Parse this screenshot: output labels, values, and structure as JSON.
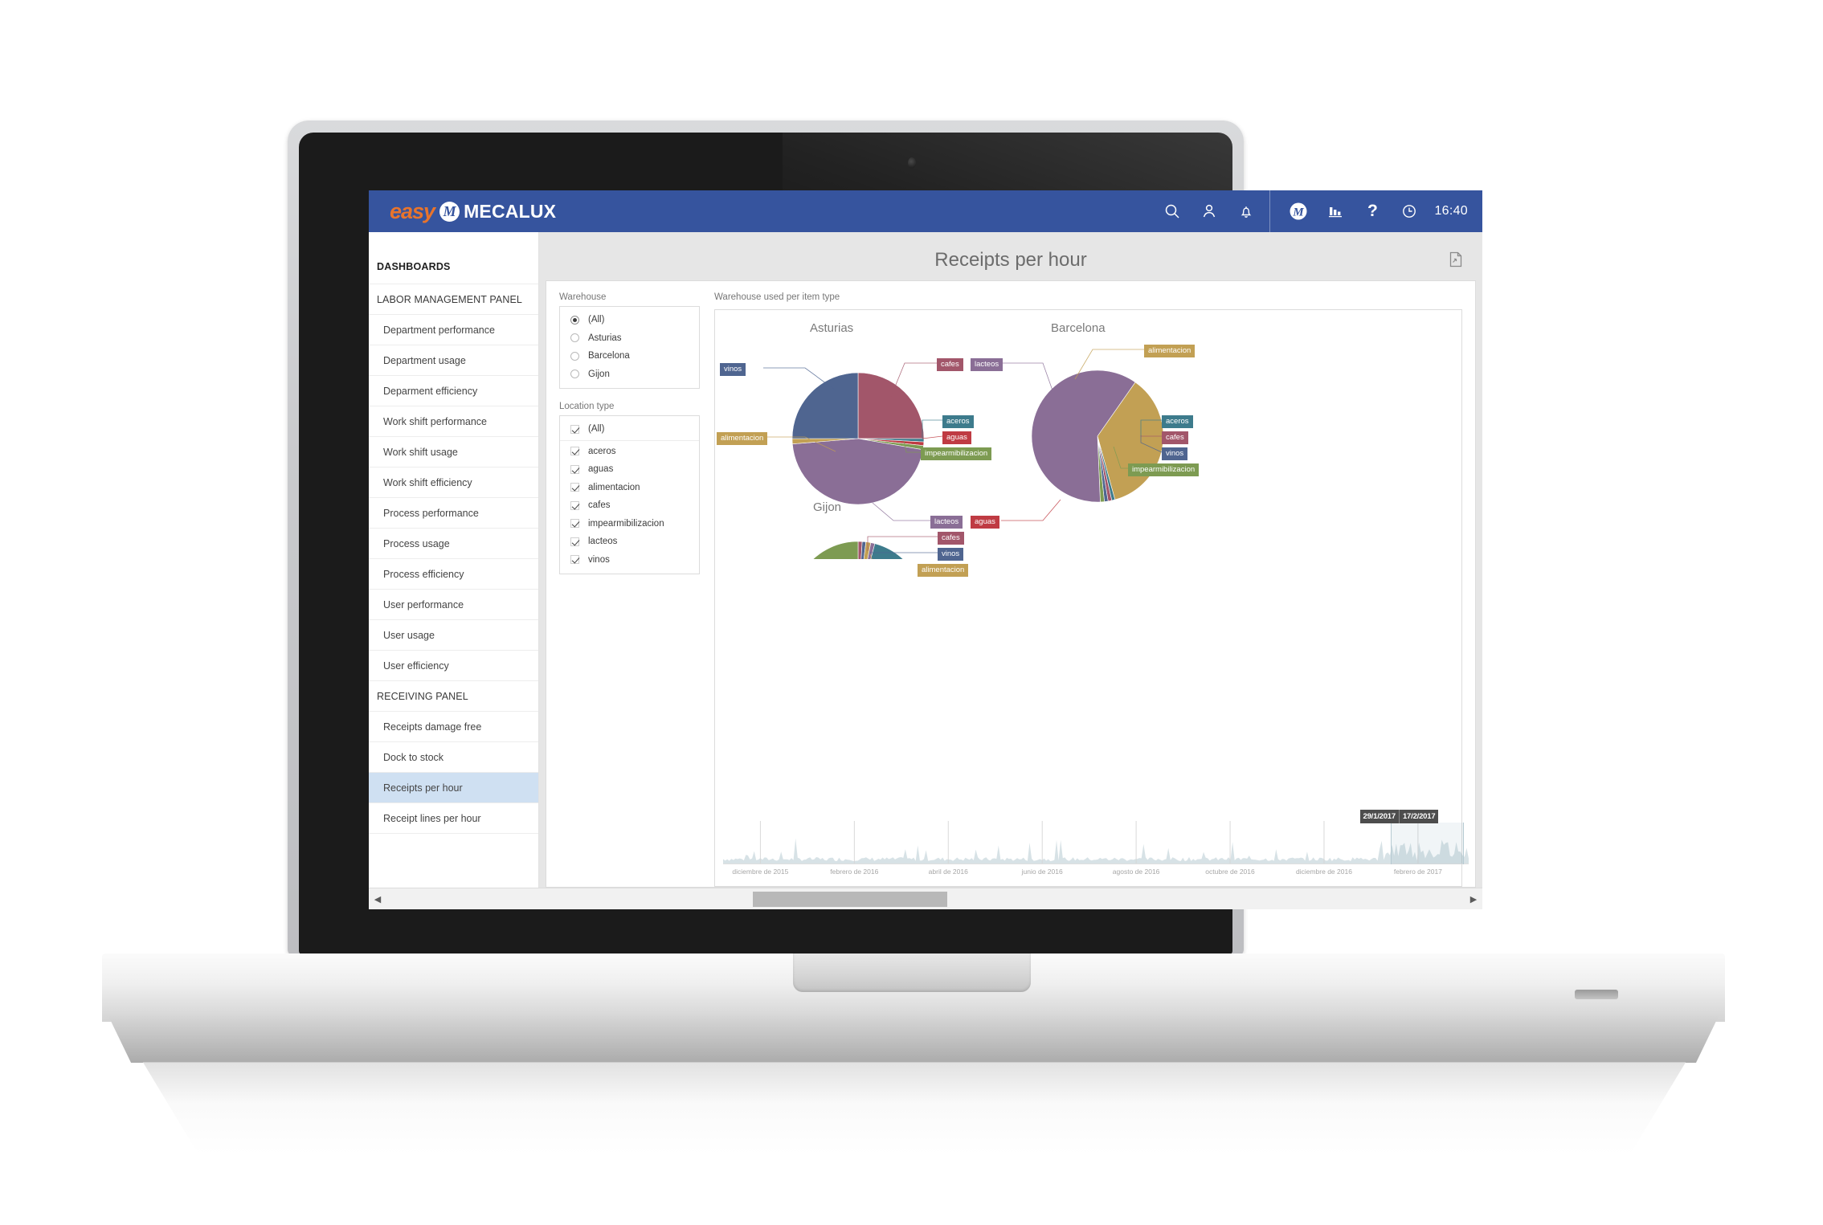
{
  "topbar": {
    "brand_easy": "easy",
    "brand_mark": "M",
    "brand_name": "MECALUX",
    "icons": [
      "search-icon",
      "user-icon",
      "bell-icon",
      "mecalux-logo-icon",
      "bar-chart-icon",
      "help-icon",
      "clock-icon"
    ],
    "help_glyph": "?",
    "clock": "16:40",
    "accent": "#36549e"
  },
  "sidebar": {
    "items": [
      {
        "label": "DASHBOARDS",
        "type": "head"
      },
      {
        "label": "LABOR MANAGEMENT PANEL",
        "type": "group"
      },
      {
        "label": "Department performance",
        "type": "child"
      },
      {
        "label": "Department usage",
        "type": "child"
      },
      {
        "label": "Deparment efficiency",
        "type": "child"
      },
      {
        "label": "Work shift performance",
        "type": "child"
      },
      {
        "label": "Work shift usage",
        "type": "child"
      },
      {
        "label": "Work shift efficiency",
        "type": "child"
      },
      {
        "label": "Process performance",
        "type": "child"
      },
      {
        "label": "Process usage",
        "type": "child"
      },
      {
        "label": "Process efficiency",
        "type": "child"
      },
      {
        "label": "User performance",
        "type": "child"
      },
      {
        "label": "User usage",
        "type": "child"
      },
      {
        "label": "User efficiency",
        "type": "child"
      },
      {
        "label": "RECEIVING PANEL",
        "type": "group"
      },
      {
        "label": "Receipts damage free",
        "type": "child"
      },
      {
        "label": "Dock to stock",
        "type": "child"
      },
      {
        "label": "Receipts per hour",
        "type": "child",
        "active": true
      },
      {
        "label": "Receipt lines per hour",
        "type": "child"
      }
    ]
  },
  "page": {
    "title": "Receipts per hour",
    "export_icon": "document-export-icon"
  },
  "filters": {
    "warehouse": {
      "label": "Warehouse",
      "options": [
        {
          "label": "(All)",
          "selected": true
        },
        {
          "label": "Asturias",
          "selected": false
        },
        {
          "label": "Barcelona",
          "selected": false
        },
        {
          "label": "Gijon",
          "selected": false
        }
      ]
    },
    "location_type": {
      "label": "Location type",
      "options": [
        {
          "label": "(All)",
          "checked": true
        },
        {
          "label": "aceros",
          "checked": true
        },
        {
          "label": "aguas",
          "checked": true
        },
        {
          "label": "alimentacion",
          "checked": true
        },
        {
          "label": "cafes",
          "checked": true
        },
        {
          "label": "impearmibilizacion",
          "checked": true
        },
        {
          "label": "lacteos",
          "checked": true
        },
        {
          "label": "vinos",
          "checked": true
        }
      ]
    }
  },
  "chart_data": {
    "type": "pie",
    "title": "Warehouse used per item type",
    "legend_position": "callout-labels",
    "series_colors": {
      "aceros": "#3d7b8c",
      "aguas": "#bf3b43",
      "alimentacion": "#c2a054",
      "cafes": "#a2566a",
      "impearmibilizacion": "#7d9b52",
      "lacteos": "#8a6e96",
      "vinos": "#4f6590"
    },
    "charts": [
      {
        "title": "Asturias",
        "categories": [
          "cafes",
          "aceros",
          "aguas",
          "impearmibilizacion",
          "lacteos",
          "alimentacion",
          "vinos"
        ],
        "values": [
          25.0,
          0.8,
          0.9,
          1.0,
          46.0,
          1.3,
          25.0
        ]
      },
      {
        "title": "Barcelona",
        "categories": [
          "alimentacion",
          "aceros",
          "cafes",
          "vinos",
          "impearmibilizacion",
          "lacteos"
        ],
        "values": [
          36.0,
          0.8,
          0.9,
          0.9,
          1.0,
          60.4
        ]
      },
      {
        "title": "Gijon",
        "categories": [
          "cafes",
          "vinos",
          "alimentacion",
          "lacteos",
          "aceros",
          "impearmibilizacion"
        ],
        "values": [
          1.0,
          0.9,
          1.2,
          1.0,
          38.0,
          57.9
        ]
      }
    ]
  },
  "timeline": {
    "type": "area",
    "ticks": [
      "diciembre de 2015",
      "febrero de 2016",
      "abril de 2016",
      "junio de 2016",
      "agosto de 2016",
      "octubre de 2016",
      "diciembre de 2016",
      "febrero de 2017"
    ],
    "selection": {
      "from": "29/1/2017",
      "to": "17/2/2017"
    }
  },
  "scrollbar": {
    "left_arrow": "◀",
    "right_arrow": "▶"
  }
}
